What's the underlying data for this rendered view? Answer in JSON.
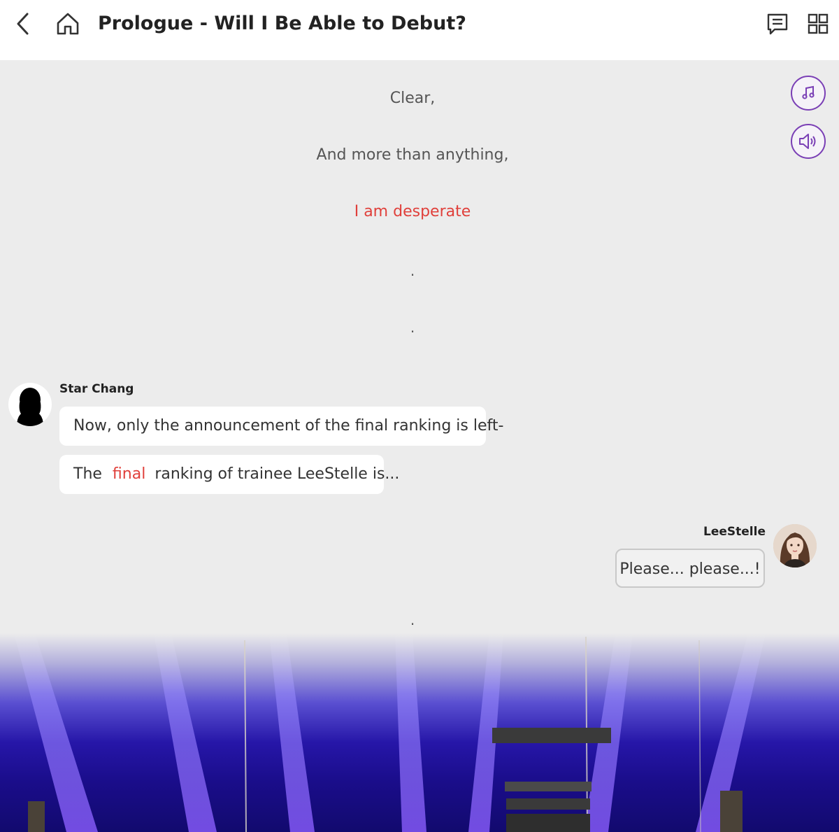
{
  "header": {
    "title": "Prologue - Will I Be Able to Debut?"
  },
  "narration": {
    "line1": "Clear,",
    "line2": "And more than anything,",
    "line3": "I am desperate",
    "dot1": ".",
    "dot2": ".",
    "dot3": "."
  },
  "messages": {
    "star": {
      "speaker": "Star Chang",
      "bubble1": "Now, only the announcement of the final ranking is left-",
      "bubble2_pre": "The ",
      "bubble2_highlight": "final",
      "bubble2_post": " ranking of trainee LeeStelle is..."
    },
    "lee": {
      "speaker": "LeeStelle",
      "bubble1": "Please... please...!"
    }
  },
  "colors": {
    "accent": "#7a3fb5",
    "highlight": "#e0403b",
    "background": "#ececec"
  },
  "icons": {
    "back": "chevron-left-icon",
    "home": "home-icon",
    "chat": "chat-list-icon",
    "grid": "grid-icon",
    "music": "music-note-icon",
    "sound": "speaker-icon"
  }
}
